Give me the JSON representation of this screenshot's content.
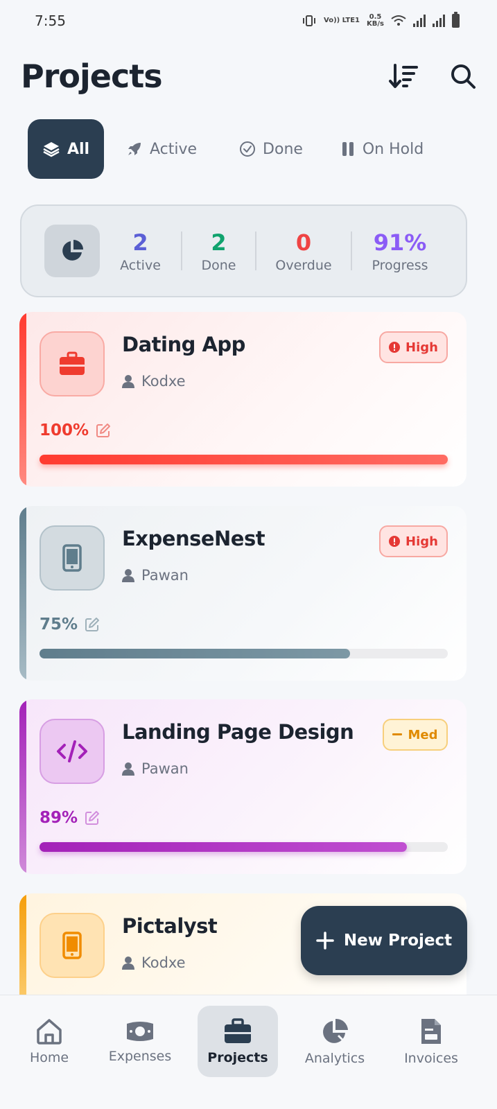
{
  "status_bar": {
    "time": "7:55",
    "net_speed": "0.5",
    "net_unit": "KB/s",
    "volte": "Vo)) LTE1"
  },
  "header": {
    "title": "Projects",
    "sort_icon": "sort-descending-icon",
    "search_icon": "search-icon"
  },
  "tabs": [
    {
      "label": "All",
      "icon": "layers-icon"
    },
    {
      "label": "Active",
      "icon": "rocket-icon"
    },
    {
      "label": "Done",
      "icon": "check-circle-icon"
    },
    {
      "label": "On Hold",
      "icon": "pause-icon"
    }
  ],
  "stats": {
    "icon": "pie-chart-icon",
    "items": [
      {
        "value": "2",
        "label": "Active",
        "color": "#5b5fd6"
      },
      {
        "value": "2",
        "label": "Done",
        "color": "#10a36e"
      },
      {
        "value": "0",
        "label": "Overdue",
        "color": "#ef4444"
      },
      {
        "value": "91%",
        "label": "Progress",
        "color": "#8b5cf6"
      }
    ]
  },
  "projects": [
    {
      "name": "Dating App",
      "owner": "Kodxe",
      "priority": "High",
      "percent_label": "100%",
      "progress": 1.0,
      "icon": "briefcase-icon",
      "accent": "#ef4444"
    },
    {
      "name": "ExpenseNest",
      "owner": "Pawan",
      "priority": "High",
      "percent_label": "75%",
      "progress": 0.76,
      "icon": "smartphone-icon",
      "accent": "#5f7d8c"
    },
    {
      "name": "Landing Page Design",
      "owner": "Pawan",
      "priority": "Med",
      "percent_label": "89%",
      "progress": 0.9,
      "icon": "code-icon",
      "accent": "#a321b8"
    },
    {
      "name": "Pictalyst",
      "owner": "Kodxe",
      "priority": "",
      "percent_label": "",
      "progress": null,
      "icon": "smartphone-icon",
      "accent": "#f59e0b"
    }
  ],
  "fab": {
    "label": "New Project",
    "icon": "plus-icon"
  },
  "bottom_nav": [
    {
      "label": "Home",
      "icon": "home-icon"
    },
    {
      "label": "Expenses",
      "icon": "money-icon"
    },
    {
      "label": "Projects",
      "icon": "briefcase-icon"
    },
    {
      "label": "Analytics",
      "icon": "pie-chart-icon"
    },
    {
      "label": "Invoices",
      "icon": "invoice-icon"
    }
  ]
}
